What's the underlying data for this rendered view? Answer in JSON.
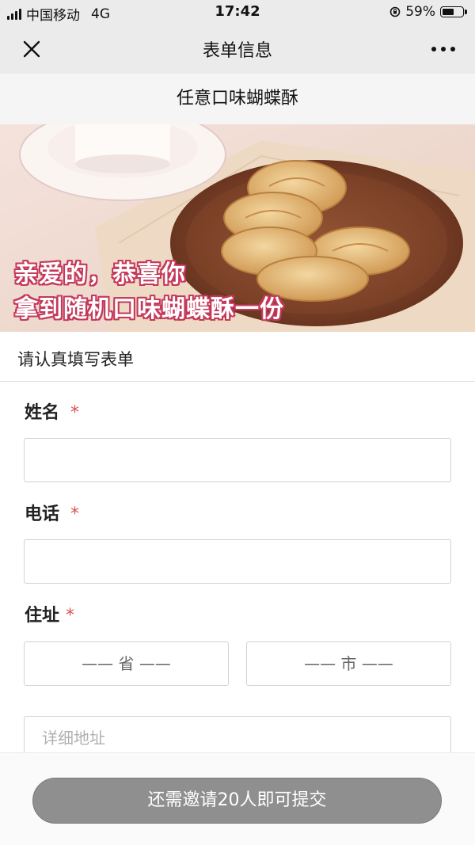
{
  "status_bar": {
    "carrier": "中国移动",
    "network": "4G",
    "time": "17:42",
    "battery_percent": "59%",
    "battery_level": 0.59
  },
  "nav": {
    "title": "表单信息",
    "close_icon": "close-icon",
    "more_icon": "more-dots-icon"
  },
  "product": {
    "title": "任意口味蝴蝶酥"
  },
  "banner": {
    "line1": "亲爱的，恭喜你",
    "line2": "拿到随机口味蝴蝶酥一份",
    "outline_color": "#c4385a"
  },
  "form": {
    "heading": "请认真填写表单",
    "required_mark": "*",
    "name_label": "姓名",
    "name_value": "",
    "phone_label": "电话",
    "phone_value": "",
    "address_label": "住址",
    "province_placeholder": "—— 省 ——",
    "city_placeholder": "—— 市 ——",
    "detail_placeholder": "详细地址"
  },
  "submit": {
    "label": "还需邀请20人即可提交",
    "color": "#8f8f8f"
  }
}
